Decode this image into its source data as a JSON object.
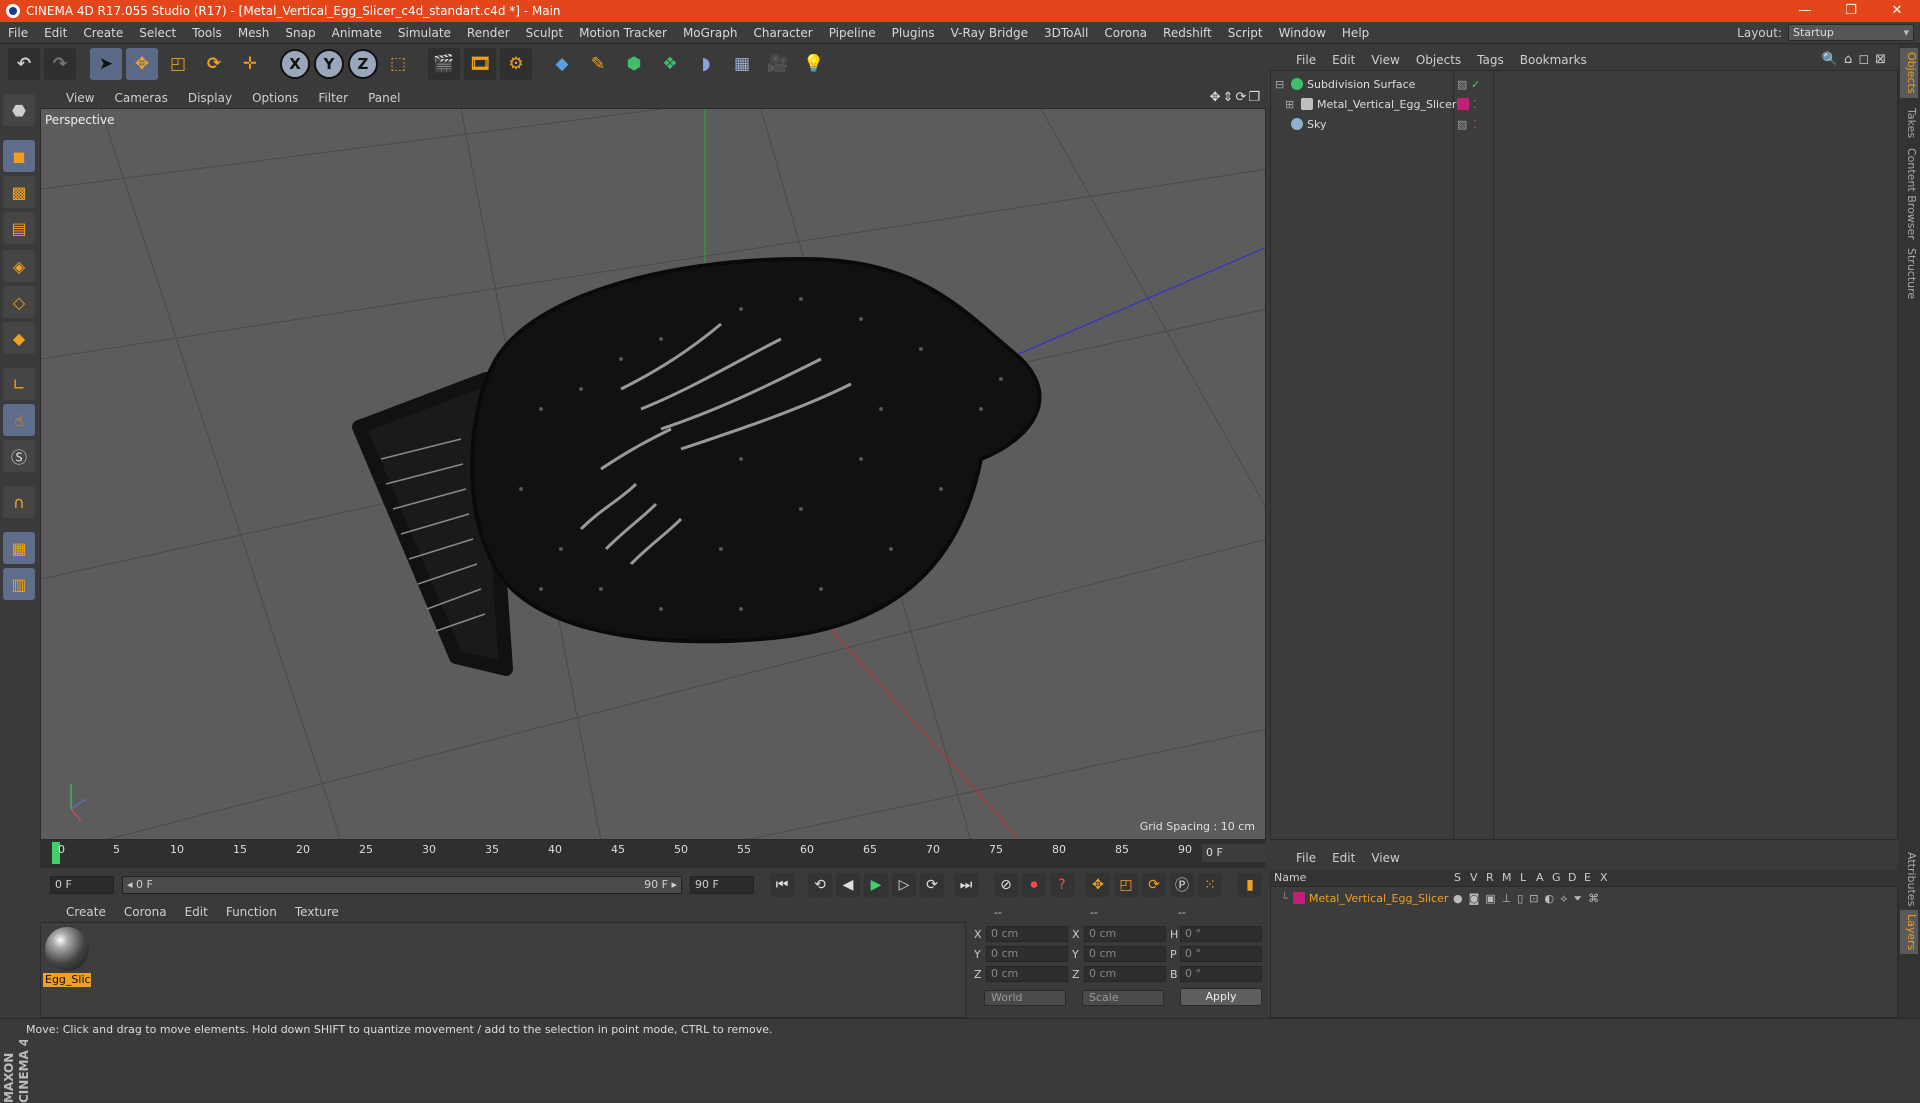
{
  "window": {
    "title": "CINEMA 4D R17.055 Studio (R17) - [Metal_Vertical_Egg_Slicer_c4d_standart.c4d *] - Main",
    "controls": [
      "—",
      "❐",
      "✕"
    ]
  },
  "menubar": {
    "items": [
      "File",
      "Edit",
      "Create",
      "Select",
      "Tools",
      "Mesh",
      "Snap",
      "Animate",
      "Simulate",
      "Render",
      "Sculpt",
      "Motion Tracker",
      "MoGraph",
      "Character",
      "Pipeline",
      "Plugins",
      "V-Ray Bridge",
      "3DToAll",
      "Corona",
      "Redshift",
      "Script",
      "Window",
      "Help"
    ],
    "layout_label": "Layout:",
    "layout_value": "Startup"
  },
  "toolbar": {
    "icons": [
      "undo-icon",
      "redo-icon",
      "select-icon",
      "move-icon",
      "scale-icon",
      "rotate-icon",
      "live-select-icon",
      "x-axis",
      "y-axis",
      "z-axis",
      "coordinate-system-icon",
      "render-view-icon",
      "render-picture-viewer-icon",
      "edit-render-settings-icon",
      "cube-icon",
      "pen-spline-icon",
      "subdivision-icon",
      "cloner-icon",
      "deformer-icon",
      "floor-icon",
      "camera-icon",
      "light-icon"
    ],
    "axis_x": "X",
    "axis_y": "Y",
    "axis_z": "Z"
  },
  "viewport": {
    "menu": [
      "View",
      "Cameras",
      "Display",
      "Options",
      "Filter",
      "Panel"
    ],
    "label": "Perspective",
    "grid_spacing": "Grid Spacing : 10 cm",
    "nav_icons": "✥⇕⟳❐"
  },
  "timeline": {
    "ticks": [
      "0",
      "5",
      "10",
      "15",
      "20",
      "25",
      "30",
      "35",
      "40",
      "45",
      "50",
      "55",
      "60",
      "65",
      "70",
      "75",
      "80",
      "85",
      "90"
    ],
    "end_field": "0 F"
  },
  "transport": {
    "current_frame": "0 F",
    "range_start": "◂ 0 F",
    "range_end": "90 F ▸",
    "max_frame": "90 F"
  },
  "material_manager": {
    "menu": [
      "Create",
      "Corona",
      "Edit",
      "Function",
      "Texture"
    ],
    "material_name": "Egg_Slic"
  },
  "coordinates": {
    "header": [
      "--",
      "--",
      "--"
    ],
    "rows": [
      {
        "label": "X",
        "pos": "0 cm",
        "size_label": "X",
        "size": "0 cm",
        "rot_label": "H",
        "rot": "0 °"
      },
      {
        "label": "Y",
        "pos": "0 cm",
        "size_label": "Y",
        "size": "0 cm",
        "rot_label": "P",
        "rot": "0 °"
      },
      {
        "label": "Z",
        "pos": "0 cm",
        "size_label": "Z",
        "size": "0 cm",
        "rot_label": "B",
        "rot": "0 °"
      }
    ],
    "mode": "World",
    "scale": "Scale",
    "apply": "Apply"
  },
  "object_manager": {
    "menu": [
      "File",
      "Edit",
      "View",
      "Objects",
      "Tags",
      "Bookmarks"
    ],
    "objects": [
      {
        "name": "Subdivision Surface",
        "icon_color": "#3fbf6a"
      },
      {
        "name": "Metal_Vertical_Egg_Slicer",
        "icon_color": "#bfbfbf"
      },
      {
        "name": "Sky",
        "icon_color": "#8fb0d0"
      }
    ]
  },
  "layers_manager": {
    "menu": [
      "File",
      "Edit",
      "View"
    ],
    "columns": [
      "Name",
      "S",
      "V",
      "R",
      "M",
      "L",
      "A",
      "G",
      "D",
      "E",
      "X"
    ],
    "layers": [
      {
        "name": "Metal_Vertical_Egg_Slicer",
        "color": "#c0207a"
      }
    ]
  },
  "right_tabs": [
    "Objects",
    "Takes",
    "Content Browser",
    "Structure",
    "Attributes",
    "Layers"
  ],
  "maxon_logo": "MAXON CINEMA 4D",
  "statusbar": {
    "text": "Move: Click and drag to move elements. Hold down SHIFT to quantize movement / add to the selection in point mode, CTRL to remove."
  }
}
